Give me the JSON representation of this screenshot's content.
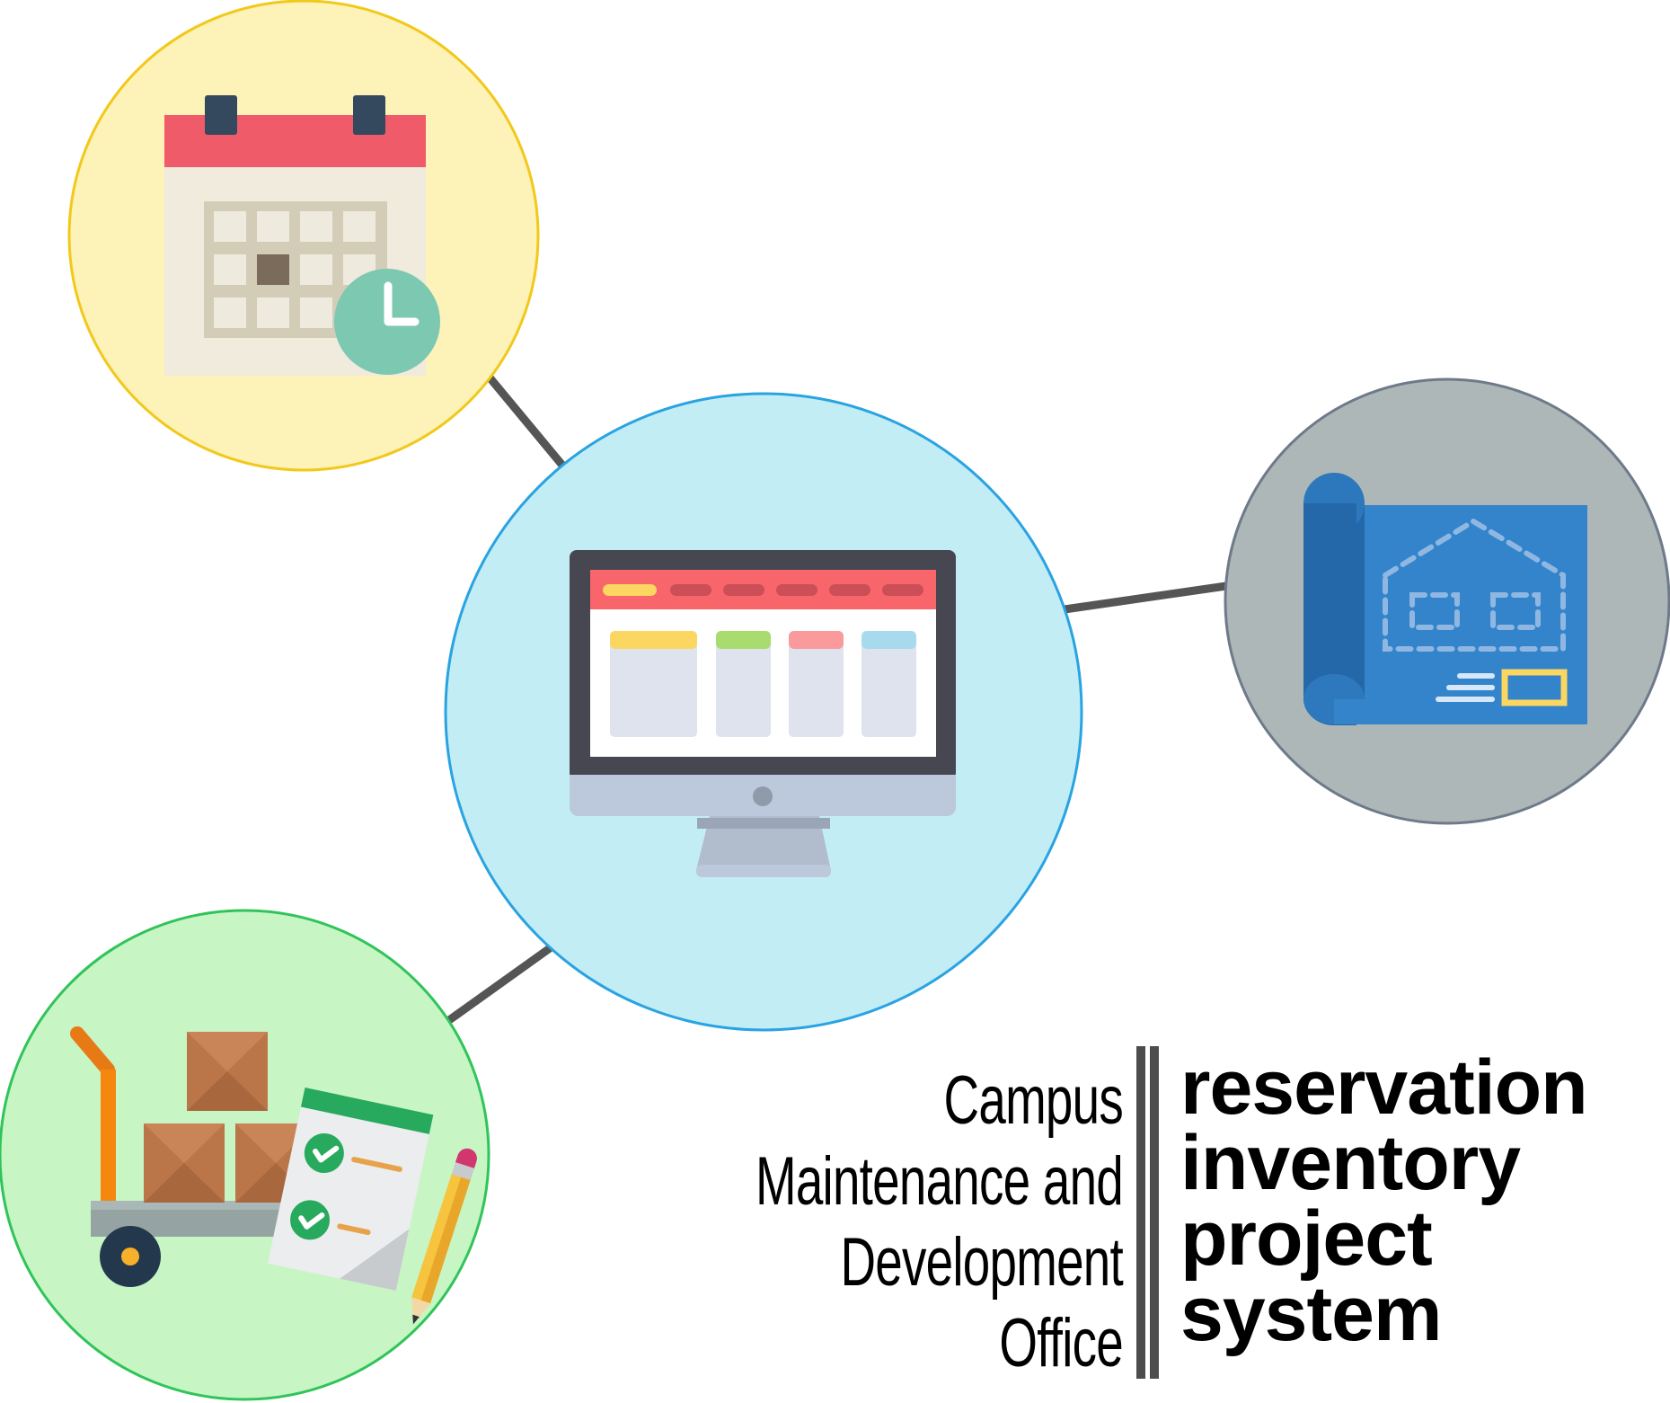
{
  "office": {
    "lines": [
      "Campus",
      "Maintenance and",
      "Development",
      "Office"
    ]
  },
  "system": {
    "lines": [
      "reservation",
      "inventory",
      "project",
      "system"
    ]
  },
  "nodes": {
    "center": {
      "icon": "computer-monitor-icon",
      "fill": "#c3edf5",
      "stroke": "#29a3e2"
    },
    "top_left": {
      "icon": "calendar-clock-icon",
      "fill": "#fdf2b8",
      "stroke": "#f2c81b"
    },
    "right": {
      "icon": "blueprint-icon",
      "fill": "#adb7b7",
      "stroke": "#6e7a8a"
    },
    "bottom_left": {
      "icon": "cart-checklist-icon",
      "fill": "#c8f5c4",
      "stroke": "#30c45a"
    }
  },
  "colors": {
    "connector": "#555555",
    "divider": "#4d4d4d",
    "text": "#000000"
  }
}
